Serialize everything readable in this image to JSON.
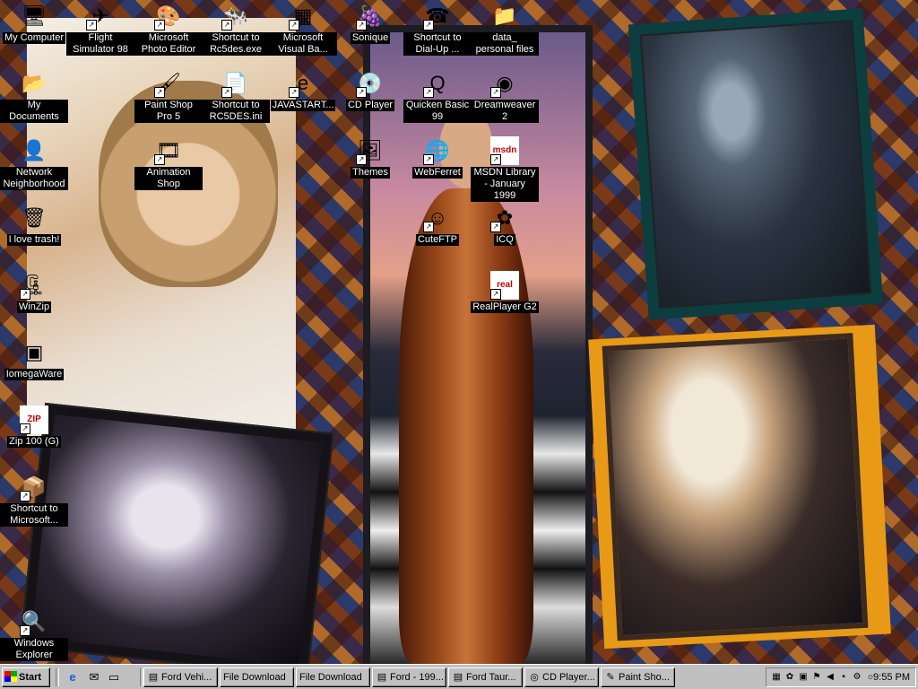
{
  "desktop": {
    "icons": [
      {
        "label": "My Computer",
        "icon": "my-computer-icon",
        "glyph": "🖥",
        "shortcut": false
      },
      {
        "label": "Flight Simulator 98",
        "icon": "flight-simulator-icon",
        "glyph": "✈",
        "shortcut": true
      },
      {
        "label": "Microsoft Photo Editor",
        "icon": "photo-editor-icon",
        "glyph": "🎨",
        "shortcut": true
      },
      {
        "label": "Shortcut to Rc5des.exe",
        "icon": "cow-icon",
        "glyph": "🐄",
        "shortcut": true
      },
      {
        "label": "Microsoft Visual Ba...",
        "icon": "visual-basic-icon",
        "glyph": "▦",
        "shortcut": true
      },
      {
        "label": "Sonique",
        "icon": "sonique-icon",
        "glyph": "🍇",
        "shortcut": true
      },
      {
        "label": "Shortcut to Dial-Up ...",
        "icon": "dial-up-icon",
        "glyph": "☎",
        "shortcut": true
      },
      {
        "label": "data_ personal files",
        "icon": "folder-icon",
        "glyph": "📁",
        "shortcut": false
      },
      {
        "label": "My Documents",
        "icon": "my-documents-icon",
        "glyph": "📂",
        "shortcut": false
      },
      {
        "label": "Paint Shop Pro 5",
        "icon": "paint-shop-pro-icon",
        "glyph": "🖌",
        "shortcut": true
      },
      {
        "label": "Shortcut to RC5DES.ini",
        "icon": "ini-file-icon",
        "glyph": "📄",
        "shortcut": true
      },
      {
        "label": "JAVASTART...",
        "icon": "internet-explorer-icon",
        "glyph": "e",
        "shortcut": true
      },
      {
        "label": "CD Player",
        "icon": "cd-player-icon",
        "glyph": "💿",
        "shortcut": true
      },
      {
        "label": "Quicken Basic 99",
        "icon": "quicken-icon",
        "glyph": "Q",
        "shortcut": true
      },
      {
        "label": "Dreamweaver 2",
        "icon": "dreamweaver-icon",
        "glyph": "◉",
        "shortcut": true
      },
      {
        "label": "Network Neighborhood",
        "icon": "network-neighborhood-icon",
        "glyph": "👤",
        "shortcut": false
      },
      {
        "label": "Animation Shop",
        "icon": "animation-shop-icon",
        "glyph": "🎞",
        "shortcut": true
      },
      {
        "label": "Themes",
        "icon": "themes-icon",
        "glyph": "🖼",
        "shortcut": true
      },
      {
        "label": "WebFerret",
        "icon": "webferret-icon",
        "glyph": "🌐",
        "shortcut": true
      },
      {
        "label": "MSDN Library - January 1999",
        "icon": "msdn-icon",
        "glyph": "msdn",
        "shortcut": true
      },
      {
        "label": "I love trash!",
        "icon": "recycle-bin-icon",
        "glyph": "🗑",
        "shortcut": false
      },
      {
        "label": "CuteFTP",
        "icon": "cuteftp-icon",
        "glyph": "☺",
        "shortcut": true
      },
      {
        "label": "ICQ",
        "icon": "icq-icon",
        "glyph": "✿",
        "shortcut": true
      },
      {
        "label": "WinZip",
        "icon": "winzip-icon",
        "glyph": "🗜",
        "shortcut": true
      },
      {
        "label": "RealPlayer G2",
        "icon": "realplayer-icon",
        "glyph": "real",
        "shortcut": true
      },
      {
        "label": "IomegaWare",
        "icon": "iomegaware-icon",
        "glyph": "▣",
        "shortcut": false
      },
      {
        "label": "Zip 100 (G)",
        "icon": "zip-drive-icon",
        "glyph": "ZIP",
        "shortcut": true
      },
      {
        "label": "Shortcut to Microsoft...",
        "icon": "microsoft-shortcut-icon",
        "glyph": "📦",
        "shortcut": true
      },
      {
        "label": "Windows Explorer",
        "icon": "windows-explorer-icon",
        "glyph": "🔍",
        "shortcut": true
      }
    ]
  },
  "taskbar": {
    "start_label": "Start",
    "quick_launch": [
      {
        "icon": "internet-explorer-icon",
        "glyph": "e"
      },
      {
        "icon": "outlook-express-icon",
        "glyph": "✉"
      },
      {
        "icon": "show-desktop-icon",
        "glyph": "▭"
      }
    ],
    "tasks": [
      {
        "label": "Ford Vehi...",
        "icon": "browser-page-icon",
        "glyph": "▤"
      },
      {
        "label": "File Download",
        "icon": "",
        "glyph": ""
      },
      {
        "label": "File Download",
        "icon": "",
        "glyph": ""
      },
      {
        "label": "Ford - 199...",
        "icon": "browser-page-icon",
        "glyph": "▤"
      },
      {
        "label": "Ford Taur...",
        "icon": "browser-page-icon",
        "glyph": "▤"
      },
      {
        "label": "CD Player...",
        "icon": "cd-player-icon",
        "glyph": "◎"
      },
      {
        "label": "Paint Sho...",
        "icon": "paint-shop-pro-icon",
        "glyph": "✎"
      }
    ],
    "tray_icons": [
      {
        "icon": "network-tray-icon",
        "glyph": "▦"
      },
      {
        "icon": "icq-tray-icon",
        "glyph": "✿"
      },
      {
        "icon": "monitor-tray-icon",
        "glyph": "▣"
      },
      {
        "icon": "task-scheduler-icon",
        "glyph": "⚑"
      },
      {
        "icon": "volume-icon",
        "glyph": "◀"
      },
      {
        "icon": "printer-tray-icon",
        "glyph": "▪"
      },
      {
        "icon": "scanner-tray-icon",
        "glyph": "⚙"
      },
      {
        "icon": "cow-tray-icon",
        "glyph": "☼"
      }
    ],
    "clock": "9:55 PM"
  }
}
